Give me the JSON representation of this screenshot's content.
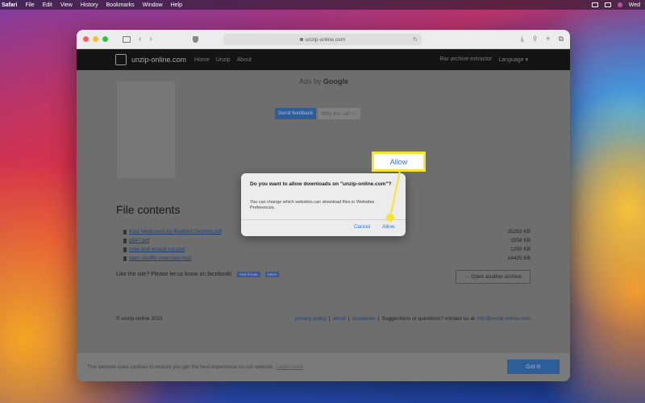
{
  "menubar": {
    "app": "Safari",
    "items": [
      "File",
      "Edit",
      "View",
      "History",
      "Bookmarks",
      "Window",
      "Help"
    ],
    "clock": "Wed"
  },
  "browser": {
    "url": "unzip-online.com"
  },
  "site": {
    "brand": "unzip-online.com",
    "nav": [
      "Home",
      "Unzip",
      "About"
    ],
    "nav_right": [
      "Rar archive extractor",
      "Language ▾"
    ]
  },
  "ads": {
    "label_prefix": "Ads by",
    "label_brand": "Google",
    "feedback": "Send feedback",
    "why": "Why this ad? ▷"
  },
  "content": {
    "title": "File contents",
    "files": [
      {
        "name": "Kipo Webcomic by Radford Sechrist.pdf",
        "size": "35283 KB"
      },
      {
        "name": "p547.pdf",
        "size": "1558 KB"
      },
      {
        "name": "robe and wizard hat.psd",
        "size": "1250 KB"
      },
      {
        "name": "slam shuffle extended.mp3",
        "size": "14425 KB"
      }
    ],
    "like_text": "Like the site? Please let us know on facebook!",
    "fb_like": "Vind ik leuk",
    "fb_share": "Delen",
    "open_another": "← Open another archive"
  },
  "footer": {
    "copyright": "© unzip-online 2021",
    "privacy": "privacy policy",
    "about": "about",
    "disclaimer": "disclaimer",
    "contact_text": "Suggestions or questions? contact us at",
    "email": "info@unzip-online.com",
    "sep": "|"
  },
  "cookie": {
    "text": "This website uses cookies to ensure you get the best experience on our website.",
    "learn": "Learn more",
    "button": "Got it!"
  },
  "dialog": {
    "question": "Do you want to allow downloads on \"unzip-online.com\"?",
    "message": "You can change which websites can download files in Websites Preferences.",
    "cancel": "Cancel",
    "allow": "Allow"
  },
  "callout": {
    "label": "Allow",
    "color": "#f5e32d"
  }
}
